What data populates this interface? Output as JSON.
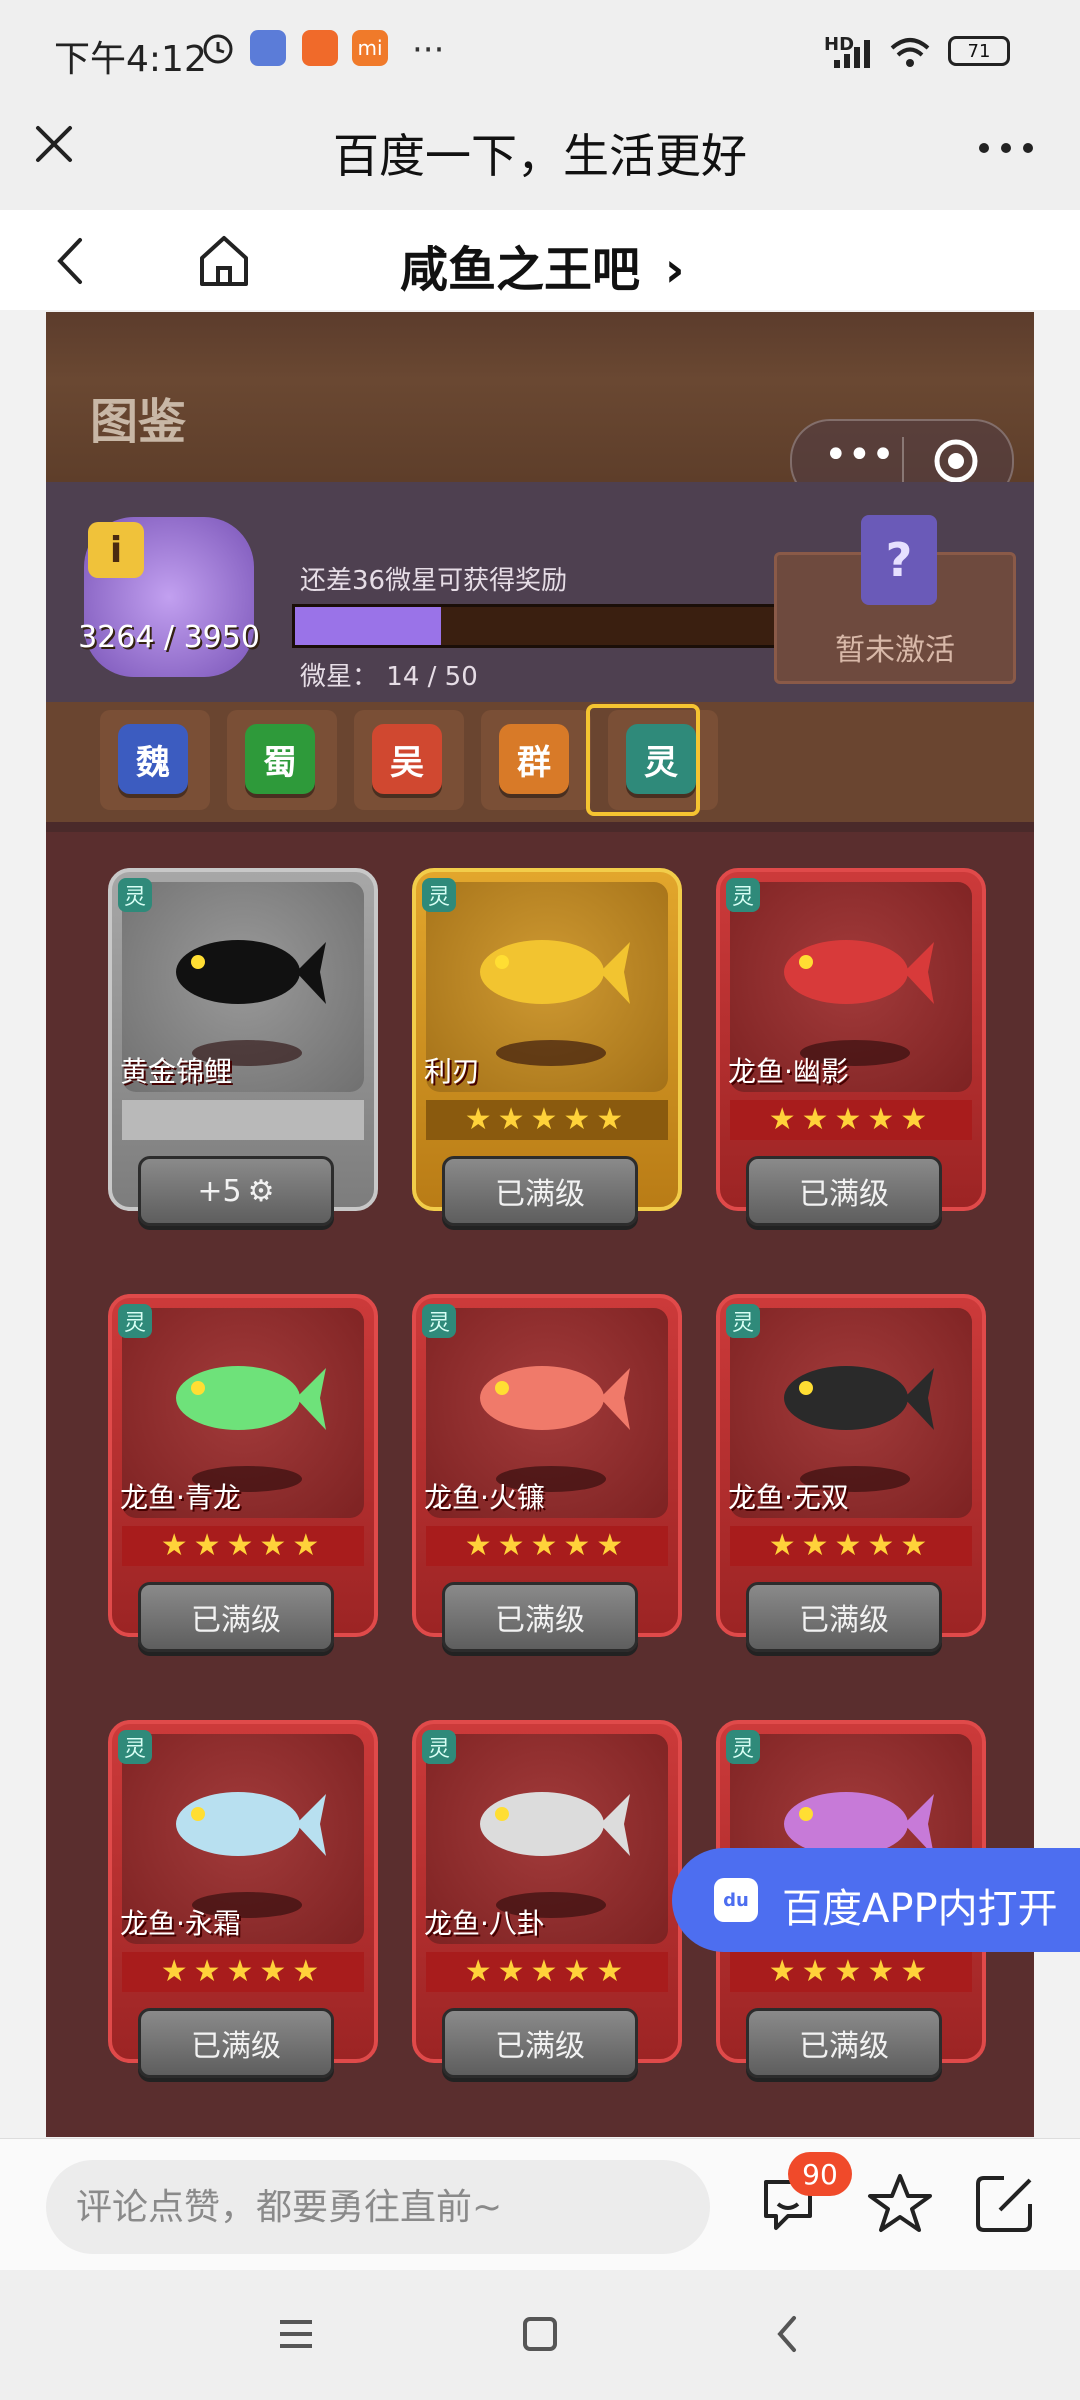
{
  "status_bar": {
    "time": "下午4:12",
    "network_label": "HD",
    "battery": "71"
  },
  "browser": {
    "title": "百度一下，生活更好"
  },
  "forum": {
    "title": "咸鱼之王吧",
    "title_arrow": "›"
  },
  "game": {
    "header_title": "图鉴",
    "score": "3264 / 3950",
    "reward_hint": "还差36微星可获得奖励",
    "progress_fraction": 0.28,
    "stars_label": "微星：",
    "stars_value": "14 / 50",
    "info_icon_label": "i",
    "question_label": "?",
    "inactive_label": "暂未激活",
    "tabs": [
      {
        "label": "魏",
        "color": "#3c5cc0"
      },
      {
        "label": "蜀",
        "color": "#2e9a3a"
      },
      {
        "label": "吴",
        "color": "#d04830"
      },
      {
        "label": "群",
        "color": "#d87a28"
      },
      {
        "label": "灵",
        "color": "#2f8a7a",
        "selected": true
      }
    ],
    "cards": [
      {
        "badge": "灵",
        "name": "黄金锦鲤",
        "style": "gray",
        "stars": "",
        "button": "+5",
        "fish_color": "#111111"
      },
      {
        "badge": "灵",
        "name": "利刃",
        "style": "gold",
        "stars": "★★★★★",
        "button": "已满级",
        "fish_color": "#f2c430"
      },
      {
        "badge": "灵",
        "name": "龙鱼·幽影",
        "style": "red",
        "stars": "★★★★★",
        "button": "已满级",
        "fish_color": "#d83a3a"
      },
      {
        "badge": "灵",
        "name": "龙鱼·青龙",
        "style": "red",
        "stars": "★★★★★",
        "button": "已满级",
        "fish_color": "#6ee27a"
      },
      {
        "badge": "灵",
        "name": "龙鱼·火镰",
        "style": "red",
        "stars": "★★★★★",
        "button": "已满级",
        "fish_color": "#f07a6a"
      },
      {
        "badge": "灵",
        "name": "龙鱼·无双",
        "style": "red",
        "stars": "★★★★★",
        "button": "已满级",
        "fish_color": "#2a2a2a"
      },
      {
        "badge": "灵",
        "name": "龙鱼·永霜",
        "style": "red",
        "stars": "★★★★★",
        "button": "已满级",
        "fish_color": "#b8e0f0"
      },
      {
        "badge": "灵",
        "name": "龙鱼·八卦",
        "style": "red",
        "stars": "★★★★★",
        "button": "已满级",
        "fish_color": "#dcdcdc"
      },
      {
        "badge": "灵",
        "name": "",
        "style": "red",
        "stars": "★★★★★",
        "button": "已满级",
        "fish_color": "#c77ad8"
      }
    ]
  },
  "open_app": {
    "label": "百度APP内打开",
    "logo": "du"
  },
  "bottom": {
    "comment_placeholder": "评论点赞，都要勇往直前~",
    "comment_count": "90"
  },
  "icons": {
    "close": "close-icon",
    "more": "more-icon",
    "back": "back-icon",
    "home": "home-icon",
    "chat": "chat-icon",
    "star": "favorite-icon",
    "share": "share-icon",
    "nav_menu": "menu-icon",
    "nav_home": "square-icon",
    "nav_back": "back-icon"
  }
}
